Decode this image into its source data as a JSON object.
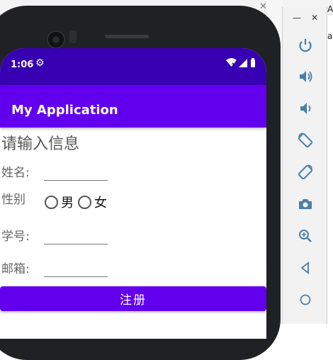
{
  "app_title": "My Application",
  "status_bar": {
    "time": "1:06"
  },
  "form": {
    "heading": "请输入信息",
    "name_label": "姓名:",
    "gender_label": "性别",
    "gender_options": [
      "男",
      "女"
    ],
    "student_id_label": "学号:",
    "email_label": "邮箱:",
    "name_value": "",
    "student_id_value": "",
    "email_value": "",
    "register_button": "注册"
  },
  "emulator_toolbar": {
    "items": [
      "power-icon",
      "volume-up-icon",
      "volume-down-icon",
      "rotate-left-icon",
      "rotate-right-icon",
      "camera-icon",
      "zoom-icon",
      "back-icon",
      "home-icon"
    ]
  },
  "colors": {
    "status_bar": "#3700b3",
    "primary": "#6200ee",
    "toolbar_icon": "#4a7fa8"
  }
}
